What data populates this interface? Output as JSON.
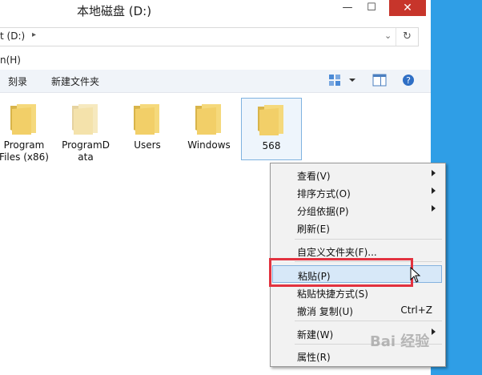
{
  "window": {
    "title": "本地磁盘 (D:)",
    "min_glyph": "—",
    "max_glyph": "☐",
    "close_glyph": "✕"
  },
  "address": {
    "path": "t (D:)",
    "chevron": "▸",
    "dropdown": "⌄",
    "refresh": "↻"
  },
  "menubar": {
    "text": "n(H)"
  },
  "toolbar": {
    "burn_label": "刻录",
    "new_folder_label": "新建文件夹",
    "icons": [
      "view-options-icon",
      "dropdown-icon",
      "preview-pane-icon",
      "help-icon"
    ]
  },
  "folders": [
    {
      "name": "Program\nFiles (x86)",
      "selected": false
    },
    {
      "name": "ProgramD\nata",
      "selected": false
    },
    {
      "name": "Users",
      "selected": false
    },
    {
      "name": "Windows",
      "selected": false
    },
    {
      "name": "568",
      "selected": true
    }
  ],
  "context_menu": {
    "items": [
      {
        "label": "查看(V)",
        "submenu": true
      },
      {
        "label": "排序方式(O)",
        "submenu": true
      },
      {
        "label": "分组依据(P)",
        "submenu": true
      },
      {
        "label": "刷新(E)"
      },
      {
        "label": "自定义文件夹(F)..."
      },
      {
        "label": "粘贴(P)",
        "highlighted": true
      },
      {
        "label": "粘贴快捷方式(S)"
      },
      {
        "label": "撤消 复制(U)",
        "shortcut": "Ctrl+Z"
      },
      {
        "label": "新建(W)",
        "submenu": true
      },
      {
        "label": "属性(R)"
      }
    ]
  },
  "watermark": "Bai 经验",
  "colors": {
    "desktop": "#2f9ee6",
    "close": "#c7352b",
    "highlight_box": "#e2323f"
  }
}
